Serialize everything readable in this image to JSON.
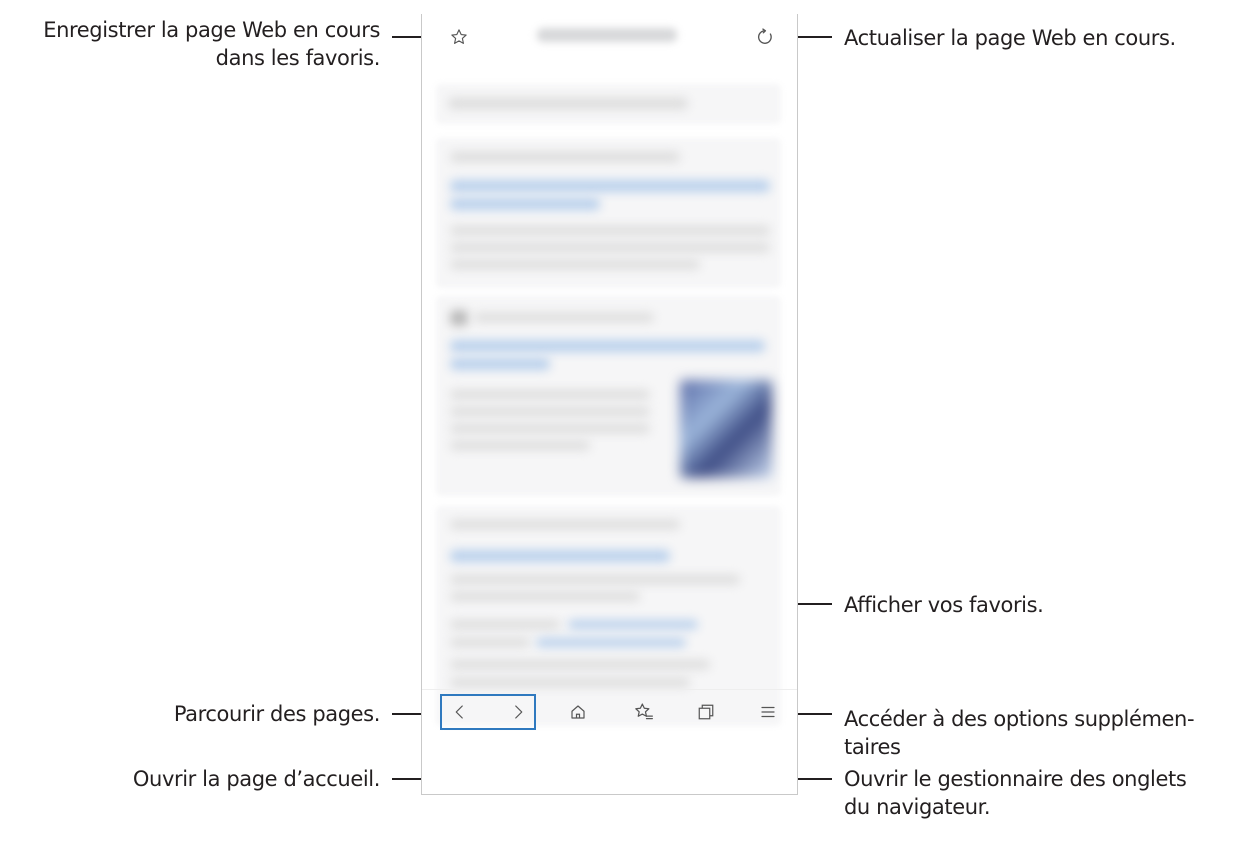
{
  "callouts": {
    "bookmark_page": "Enregistrer la page Web en cours\ndans les favoris.",
    "refresh": "Actualiser la page Web en cours.",
    "show_bookmarks": "Afficher vos favoris.",
    "browse_pages": "Parcourir des pages.",
    "more_options": "Accéder à des options supplémen-\ntaires",
    "home_page": "Ouvrir la page d’accueil.",
    "tab_manager": "Ouvrir le gestionnaire des onglets\ndu navigateur."
  },
  "toolbar": {
    "top": [
      "star-outline-icon",
      "refresh-icon"
    ],
    "bottom": [
      "back-chevron-icon",
      "forward-chevron-icon",
      "home-icon",
      "bookmarks-list-icon",
      "tabs-icon",
      "menu-icon"
    ]
  },
  "colors": {
    "highlight_box": "#2f79bf",
    "leader_lines": "#231f20",
    "link_blur": "#b9d0ec"
  }
}
